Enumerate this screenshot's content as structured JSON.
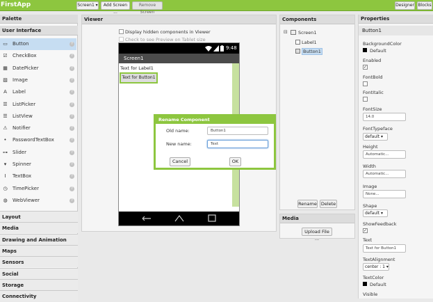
{
  "app": {
    "title": "FirstApp"
  },
  "toolbar": {
    "screen_select": "Screen1 ▾",
    "add_screen": "Add Screen ...",
    "remove_screen": "Remove Screen",
    "designer": "Designer",
    "blocks": "Blocks"
  },
  "palette": {
    "title": "Palette",
    "open_category": "User Interface",
    "items": [
      {
        "label": "Button",
        "icon": "button-icon"
      },
      {
        "label": "CheckBox",
        "icon": "checkbox-icon"
      },
      {
        "label": "DatePicker",
        "icon": "datepicker-icon"
      },
      {
        "label": "Image",
        "icon": "image-icon"
      },
      {
        "label": "Label",
        "icon": "label-icon"
      },
      {
        "label": "ListPicker",
        "icon": "listpicker-icon"
      },
      {
        "label": "ListView",
        "icon": "listview-icon"
      },
      {
        "label": "Notifier",
        "icon": "notifier-icon"
      },
      {
        "label": "PasswordTextBox",
        "icon": "password-icon"
      },
      {
        "label": "Slider",
        "icon": "slider-icon"
      },
      {
        "label": "Spinner",
        "icon": "spinner-icon"
      },
      {
        "label": "TextBox",
        "icon": "textbox-icon"
      },
      {
        "label": "TimePicker",
        "icon": "timepicker-icon"
      },
      {
        "label": "WebViewer",
        "icon": "webviewer-icon"
      }
    ],
    "categories": [
      "Layout",
      "Media",
      "Drawing and Animation",
      "Maps",
      "Sensors",
      "Social",
      "Storage",
      "Connectivity"
    ]
  },
  "viewer": {
    "title": "Viewer",
    "hidden_components": "Display hidden components in Viewer",
    "tablet_preview": "Check to see Preview on Tablet size",
    "phone": {
      "time": "9:48",
      "screen_title": "Screen1",
      "label_text": "Text for Label1",
      "button_text": "Text for Button1"
    }
  },
  "dialog": {
    "title": "Rename Component",
    "old_name_label": "Old name:",
    "old_name_value": "Button1",
    "new_name_label": "New name:",
    "new_name_value": "Text",
    "cancel": "Cancel",
    "ok": "OK"
  },
  "components": {
    "title": "Components",
    "tree": [
      "Screen1",
      "Label1",
      "Button1"
    ],
    "rename": "Rename",
    "delete": "Delete"
  },
  "media": {
    "title": "Media",
    "upload": "Upload File ..."
  },
  "properties": {
    "title": "Properties",
    "component": "Button1",
    "background_color_label": "BackgroundColor",
    "background_color_value": "Default",
    "enabled_label": "Enabled",
    "fontbold_label": "FontBold",
    "fontitalic_label": "FontItalic",
    "fontsize_label": "FontSize",
    "fontsize_value": "14.0",
    "fonttypeface_label": "FontTypeface",
    "fonttypeface_value": "default ▾",
    "height_label": "Height",
    "height_value": "Automatic...",
    "width_label": "Width",
    "width_value": "Automatic...",
    "image_label": "Image",
    "image_value": "None...",
    "shape_label": "Shape",
    "shape_value": "default ▾",
    "showfeedback_label": "ShowFeedback",
    "text_label": "Text",
    "text_value": "Text for Button1",
    "textalignment_label": "TextAlignment",
    "textalignment_value": "center : 1 ▾",
    "textcolor_label": "TextColor",
    "textcolor_value": "Default",
    "visible_label": "Visible"
  },
  "colors": {
    "accent": "#8dc63f",
    "selection": "#c6ddf2"
  }
}
